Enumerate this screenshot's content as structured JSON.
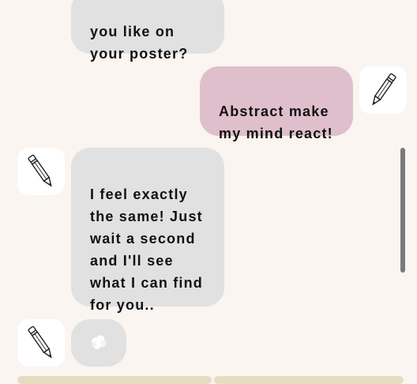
{
  "chat": {
    "messages": [
      {
        "sender": "bot",
        "text": "you like on\nyour poster?"
      },
      {
        "sender": "user",
        "text": "Abstract make\nmy mind react!"
      },
      {
        "sender": "bot",
        "text": "I feel exactly\nthe same! Just\nwait a second\nand I'll see\nwhat I can find\nfor you.."
      }
    ],
    "typing_indicator": {
      "icon": "loading-puff-icon"
    }
  },
  "avatars": {
    "bot_icon": "pencil-icon",
    "user_icon": "pencil-icon"
  },
  "colors": {
    "background": "#faf5f1",
    "bot_bubble": "#e1e1e1",
    "user_bubble": "#dfbfcb",
    "scrollbar": "#7a7a7a",
    "option_strip": "#e7dcc0"
  }
}
